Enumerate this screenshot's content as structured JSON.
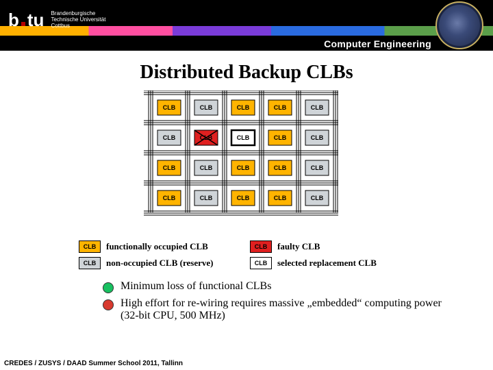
{
  "header": {
    "logo_b": "b",
    "logo_tu": "tu",
    "logo_sub_l1": "Brandenburgische",
    "logo_sub_l2": "Technische Universität",
    "logo_sub_l3": "Cottbus",
    "department": "Computer Engineering"
  },
  "title": "Distributed Backup CLBs",
  "diagram": {
    "cell_label": "CLB",
    "grid_rows": 4,
    "grid_cols": 5,
    "colors": {
      "functional": "#ffb400",
      "reserve": "#cfd4d8",
      "faulty": "#e02020",
      "selected": "#ffffff"
    },
    "cell_colors": [
      [
        "orange",
        "grey",
        "orange",
        "orange",
        "grey"
      ],
      [
        "grey",
        "red",
        "white",
        "orange",
        "grey"
      ],
      [
        "orange",
        "grey",
        "orange",
        "orange",
        "grey"
      ],
      [
        "orange",
        "grey",
        "orange",
        "orange",
        "grey"
      ]
    ],
    "selected_cell": {
      "row": 1,
      "col": 2
    }
  },
  "legend": {
    "functional": "functionally occupied CLB",
    "reserve": "non-occupied CLB (reserve)",
    "faulty": "faulty CLB",
    "selected": "selected replacement CLB"
  },
  "bullets": {
    "b1": "Minimum loss of functional CLBs",
    "b2": "High effort for re-wiring requires massive „embedded“ computing power (32-bit CPU, 500 MHz)"
  },
  "footer": "CREDES / ZUSYS / DAAD Summer School 2011, Tallinn"
}
